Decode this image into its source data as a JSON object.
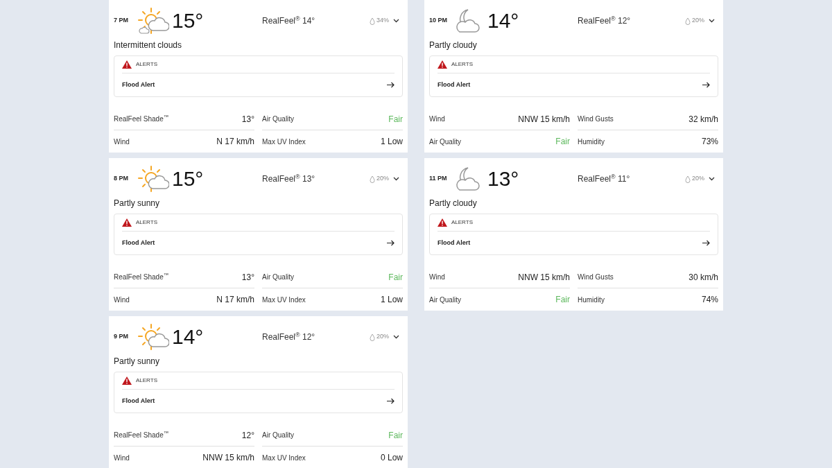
{
  "columns": [
    {
      "cards": [
        {
          "time": "7 PM",
          "kind": "intermittent",
          "temp": "15°",
          "realfeel": "RealFeel$^{®}$ 14°",
          "precip": "34%",
          "condition": "Intermittent clouds",
          "alert_heading": "ALERTS",
          "alert": "Flood Alert",
          "details": [
            {
              "label": "RealFeel Shade$^{™}$",
              "value": "13°",
              "kind": "plain"
            },
            {
              "label": "Air Quality",
              "value": "Fair",
              "kind": "rating"
            },
            {
              "label": "Wind",
              "value": "N 17 km/h",
              "kind": "plain"
            },
            {
              "label": "Max UV Index",
              "value": "1 Low",
              "kind": "plain"
            }
          ]
        },
        {
          "time": "8 PM",
          "kind": "sun-cloud",
          "temp": "15°",
          "realfeel": "RealFeel$^{®}$ 13°",
          "precip": "20%",
          "condition": "Partly sunny",
          "alert_heading": "ALERTS",
          "alert": "Flood Alert",
          "details": [
            {
              "label": "RealFeel Shade$^{™}$",
              "value": "13°",
              "kind": "plain"
            },
            {
              "label": "Air Quality",
              "value": "Fair",
              "kind": "rating"
            },
            {
              "label": "Wind",
              "value": "N 17 km/h",
              "kind": "plain"
            },
            {
              "label": "Max UV Index",
              "value": "1 Low",
              "kind": "plain"
            }
          ]
        },
        {
          "time": "9 PM",
          "kind": "sun-cloud",
          "temp": "14°",
          "realfeel": "RealFeel$^{®}$ 12°",
          "precip": "20%",
          "condition": "Partly sunny",
          "alert_heading": "ALERTS",
          "alert": "Flood Alert",
          "details": [
            {
              "label": "RealFeel Shade$^{™}$",
              "value": "12°",
              "kind": "plain"
            },
            {
              "label": "Air Quality",
              "value": "Fair",
              "kind": "rating"
            },
            {
              "label": "Wind",
              "value": "NNW 15 km/h",
              "kind": "plain"
            },
            {
              "label": "Max UV Index",
              "value": "0 Low",
              "kind": "plain"
            }
          ]
        }
      ]
    },
    {
      "cards": [
        {
          "time": "10 PM",
          "kind": "moon-cloud",
          "temp": "14°",
          "realfeel": "RealFeel$^{®}$ 12°",
          "precip": "20%",
          "condition": "Partly cloudy",
          "alert_heading": "ALERTS",
          "alert": "Flood Alert",
          "details": [
            {
              "label": "Wind",
              "value": "NNW 15 km/h",
              "kind": "plain"
            },
            {
              "label": "Wind Gusts",
              "value": "32 km/h",
              "kind": "plain"
            },
            {
              "label": "Air Quality",
              "value": "Fair",
              "kind": "rating"
            },
            {
              "label": "Humidity",
              "value": "73%",
              "kind": "plain"
            }
          ]
        },
        {
          "time": "11 PM",
          "kind": "moon-cloud",
          "temp": "13°",
          "realfeel": "RealFeel$^{®}$ 11°",
          "precip": "20%",
          "condition": "Partly cloudy",
          "alert_heading": "ALERTS",
          "alert": "Flood Alert",
          "details": [
            {
              "label": "Wind",
              "value": "NNW 15 km/h",
              "kind": "plain"
            },
            {
              "label": "Wind Gusts",
              "value": "30 km/h",
              "kind": "plain"
            },
            {
              "label": "Air Quality",
              "value": "Fair",
              "kind": "rating"
            },
            {
              "label": "Humidity",
              "value": "74%",
              "kind": "plain"
            }
          ]
        }
      ]
    }
  ]
}
